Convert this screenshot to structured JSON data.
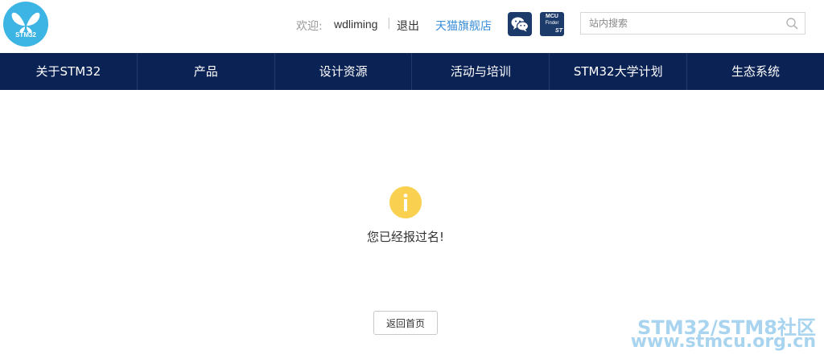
{
  "logo": {
    "text": "STM32"
  },
  "header": {
    "welcome_label": "欢迎:",
    "username": "wdliming",
    "separator": "|",
    "logout_label": "退出",
    "tmall_label": "天猫旗舰店",
    "mcu_finder": {
      "line1": "MCU",
      "line2": "Finder",
      "brand": "ST"
    },
    "search": {
      "placeholder": "站内搜索",
      "value": ""
    }
  },
  "nav": {
    "items": [
      {
        "label": "关于STM32"
      },
      {
        "label": "产品"
      },
      {
        "label": "设计资源"
      },
      {
        "label": "活动与培训"
      },
      {
        "label": "STM32大学计划"
      },
      {
        "label": "生态系统"
      }
    ]
  },
  "main": {
    "message": "您已经报过名!",
    "back_button_label": "返回首页"
  },
  "watermark": {
    "line1": "STM32/STM8社区",
    "line2": "www.stmcu.org.cn"
  },
  "colors": {
    "nav_bg": "#0b2254",
    "logo_bg": "#3cb4e4",
    "info_icon": "#f9d04f",
    "link": "#3a8dd8"
  }
}
